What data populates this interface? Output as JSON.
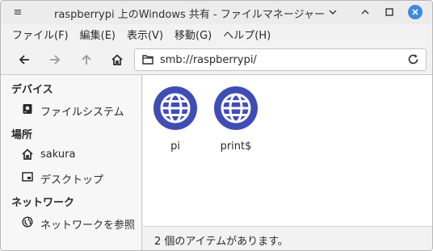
{
  "window": {
    "title": "raspberrypi 上のWindows 共有 - ファイルマネージャー",
    "menu_glyph": "≡",
    "minimize_glyph": "⌄",
    "maximize_glyph": "□",
    "close_glyph": "✕"
  },
  "menubar": [
    {
      "label": "ファイル(F)"
    },
    {
      "label": "編集(E)"
    },
    {
      "label": "表示(V)"
    },
    {
      "label": "移動(G)"
    },
    {
      "label": "ヘルプ(H)"
    }
  ],
  "toolbar": {
    "path": "smb://raspberrypi/"
  },
  "sidebar": {
    "sections": [
      {
        "title": "デバイス",
        "items": [
          {
            "label": "ファイルシステム",
            "icon": "drive-icon"
          }
        ]
      },
      {
        "title": "場所",
        "items": [
          {
            "label": "sakura",
            "icon": "home-icon"
          },
          {
            "label": "デスクトップ",
            "icon": "desktop-icon"
          }
        ]
      },
      {
        "title": "ネットワーク",
        "items": [
          {
            "label": "ネットワークを参照",
            "icon": "network-icon"
          }
        ]
      }
    ]
  },
  "files": [
    {
      "name": "pi",
      "icon": "network-share-icon"
    },
    {
      "name": "print$",
      "icon": "network-share-icon"
    }
  ],
  "status": {
    "text": "2 個のアイテムがあります。"
  },
  "colors": {
    "accent": "#3f8ae0",
    "globe": "#3f4db5"
  }
}
